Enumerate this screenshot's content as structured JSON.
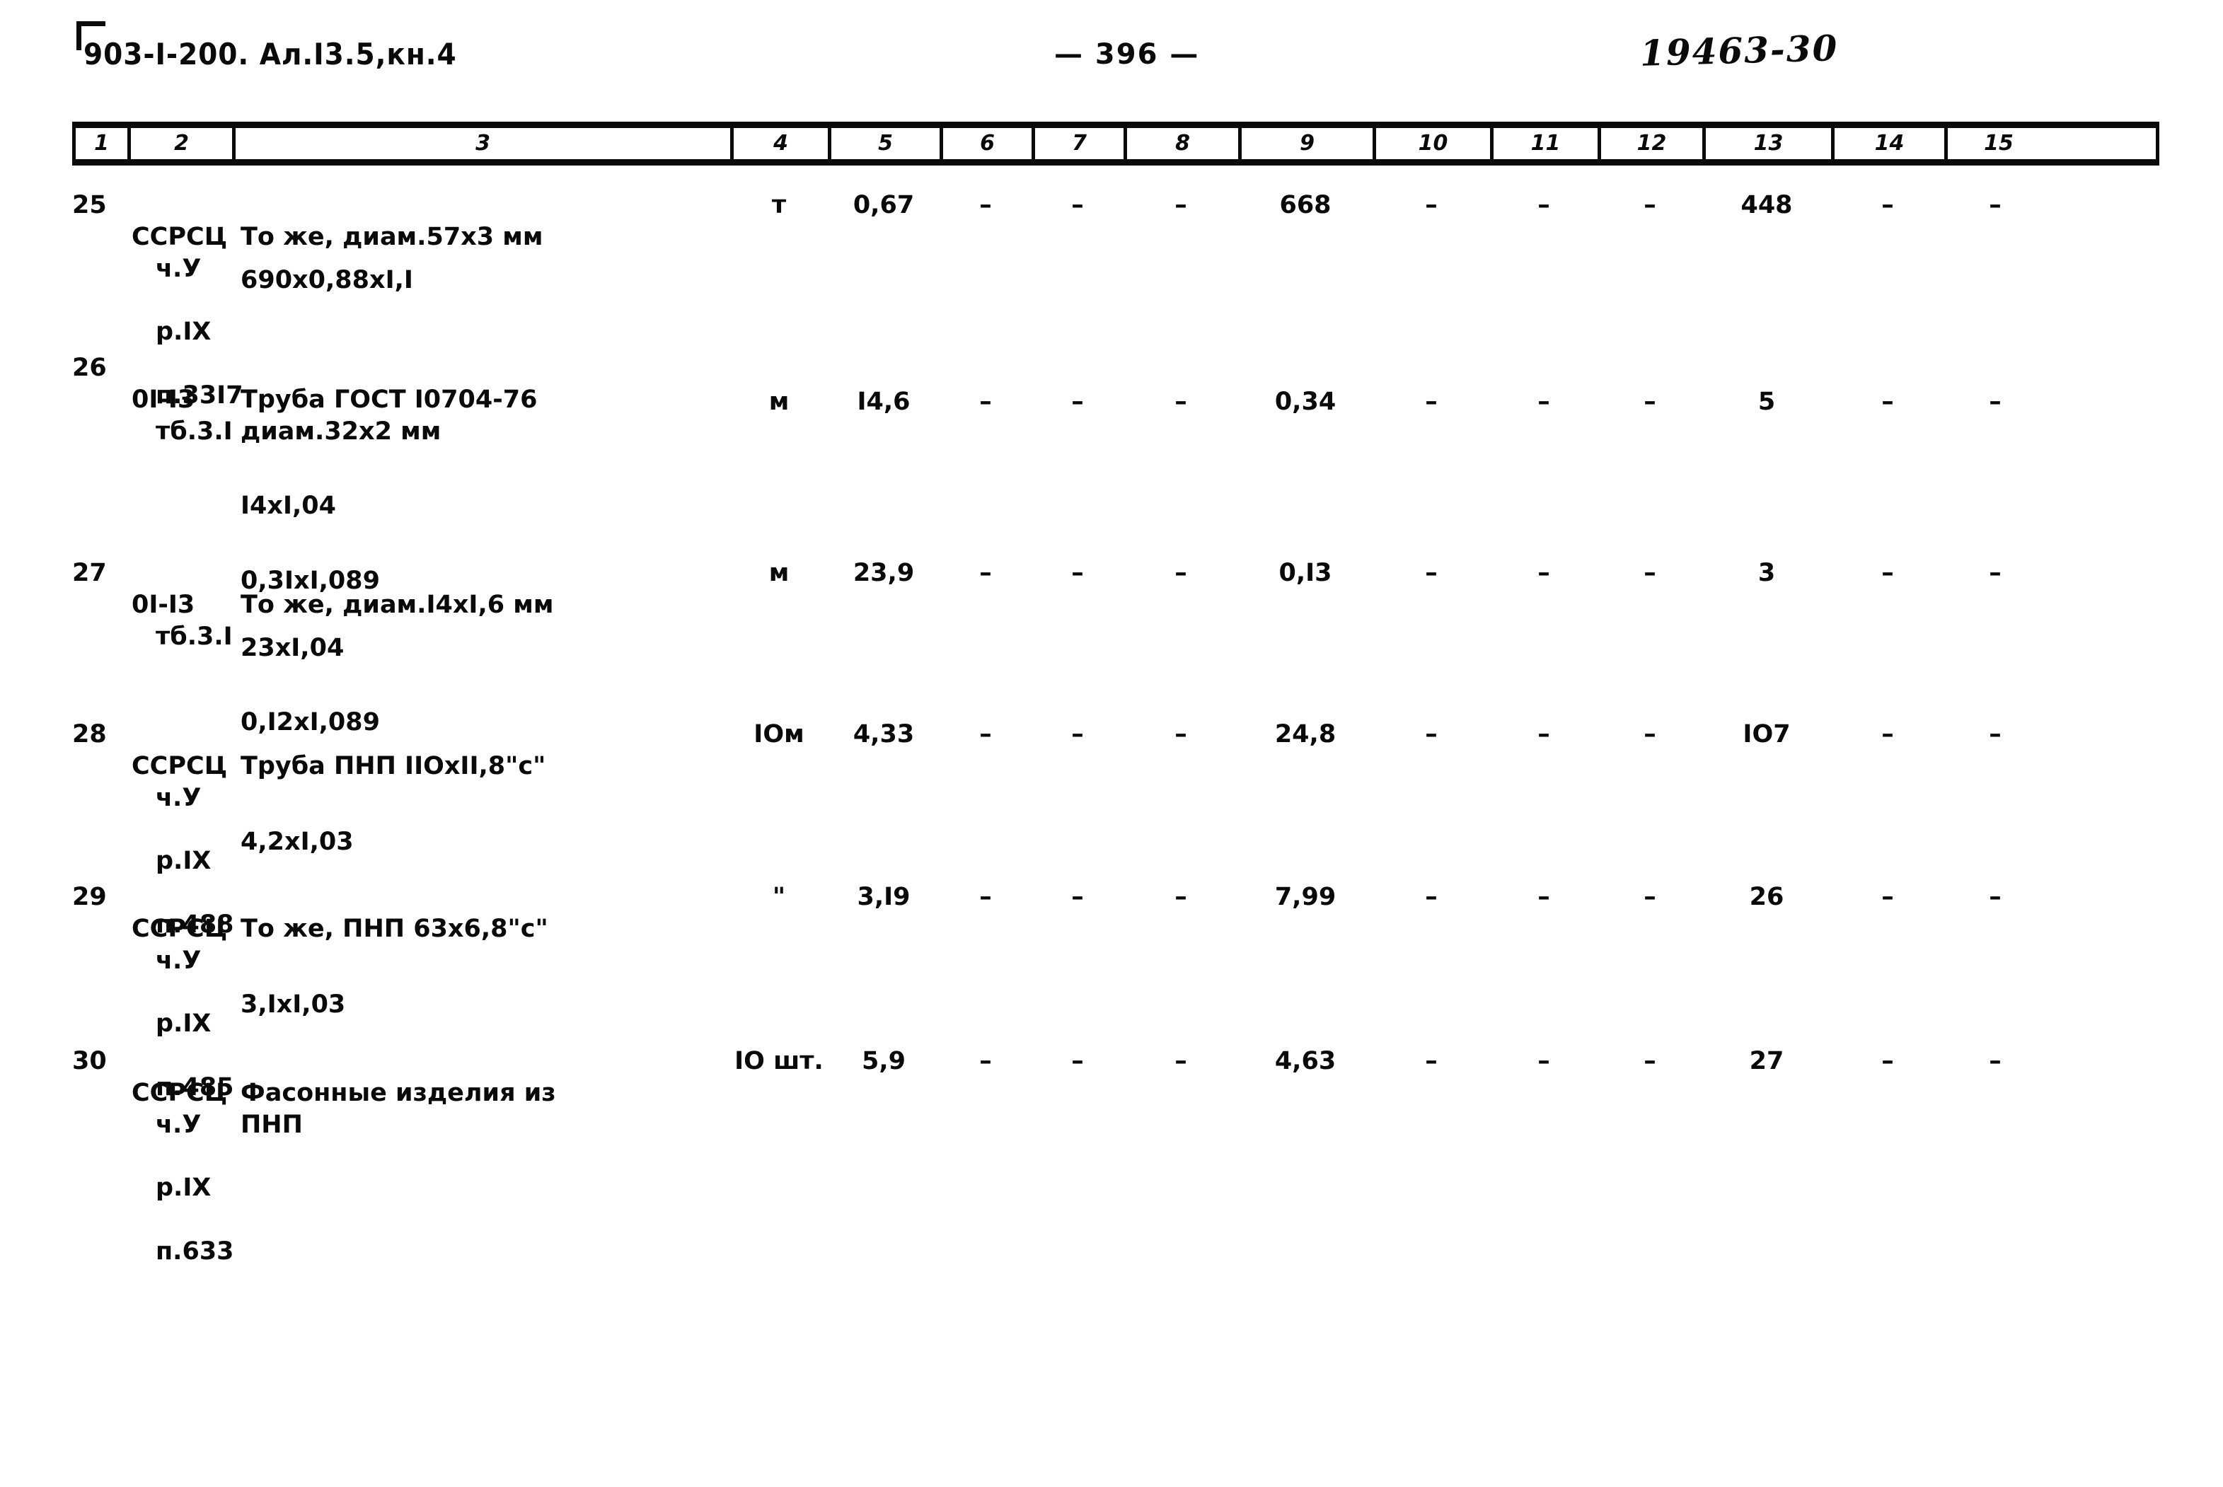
{
  "header": {
    "doc_code": "903-I-200. Ал.I3.5,кн.4",
    "page_number": "— 396 —",
    "stamp_code": "19463-30"
  },
  "table": {
    "column_numbers": [
      "1",
      "2",
      "3",
      "4",
      "5",
      "6",
      "7",
      "8",
      "9",
      "10",
      "11",
      "12",
      "13",
      "14",
      "15"
    ],
    "dash": "–",
    "rows": [
      {
        "num": "25",
        "code_line1": "ССРСЦ",
        "code_line2": "ч.У",
        "code_line3": "р.IX",
        "code_line4": "п.33I7",
        "desc_line1": "То же, диам.57х3 мм",
        "desc_line2": "690х0,88хI,I",
        "desc_line3": "",
        "desc_line4": "",
        "unit": "т",
        "c5": "0,67",
        "c6": "–",
        "c7": "–",
        "c8": "–",
        "c9": "668",
        "c10": "–",
        "c11": "–",
        "c12": "–",
        "c13": "448",
        "c14": "–",
        "c15": "–"
      },
      {
        "num": "26",
        "code_line1": "0I-I3",
        "code_line2": "тб.3.I",
        "code_line3": "",
        "code_line4": "",
        "desc_line1": "Труба ГОСТ I0704-76",
        "desc_line2": "диам.32х2 мм",
        "desc_line3": "I4хI,04",
        "desc_line4": "0,3IхI,089",
        "unit": "м",
        "c5": "I4,6",
        "c6": "–",
        "c7": "–",
        "c8": "–",
        "c9": "0,34",
        "c10": "–",
        "c11": "–",
        "c12": "–",
        "c13": "5",
        "c14": "–",
        "c15": "–"
      },
      {
        "num": "27",
        "code_line1": "0I-I3",
        "code_line2": "тб.3.I",
        "code_line3": "",
        "code_line4": "",
        "desc_line1": "То же, диам.I4хI,6 мм",
        "desc_line2": "23хI,04",
        "desc_line3": "0,I2хI,089",
        "desc_line4": "",
        "unit": "м",
        "c5": "23,9",
        "c6": "–",
        "c7": "–",
        "c8": "–",
        "c9": "0,I3",
        "c10": "–",
        "c11": "–",
        "c12": "–",
        "c13": "3",
        "c14": "–",
        "c15": "–"
      },
      {
        "num": "28",
        "code_line1": "ССРСЦ",
        "code_line2": "ч.У",
        "code_line3": "р.IX",
        "code_line4": "п.488",
        "desc_line1": "Труба ПНП IIОхII,8\"с\"",
        "desc_line2": "4,2хI,03",
        "desc_line3": "",
        "desc_line4": "",
        "unit": "IОм",
        "c5": "4,33",
        "c6": "–",
        "c7": "–",
        "c8": "–",
        "c9": "24,8",
        "c10": "–",
        "c11": "–",
        "c12": "–",
        "c13": "IО7",
        "c14": "–",
        "c15": "–"
      },
      {
        "num": "29",
        "code_line1": "ССРСЦ",
        "code_line2": "ч.У",
        "code_line3": "р.IX",
        "code_line4": "п.485",
        "desc_line1": "То же, ПНП 63х6,8\"с\"",
        "desc_line2": "3,IхI,03",
        "desc_line3": "",
        "desc_line4": "",
        "unit": "\"",
        "c5": "3,I9",
        "c6": "–",
        "c7": "–",
        "c8": "–",
        "c9": "7,99",
        "c10": "–",
        "c11": "–",
        "c12": "–",
        "c13": "26",
        "c14": "–",
        "c15": "–"
      },
      {
        "num": "30",
        "code_line1": "ССРСЦ",
        "code_line2": "ч.У",
        "code_line3": "р.IX",
        "code_line4": "п.633",
        "desc_line1": "Фасонные изделия из",
        "desc_line2": "ПНП",
        "desc_line3": "",
        "desc_line4": "",
        "unit": "IО шт.",
        "c5": "5,9",
        "c6": "–",
        "c7": "–",
        "c8": "–",
        "c9": "4,63",
        "c10": "–",
        "c11": "–",
        "c12": "–",
        "c13": "27",
        "c14": "–",
        "c15": "–"
      }
    ]
  }
}
